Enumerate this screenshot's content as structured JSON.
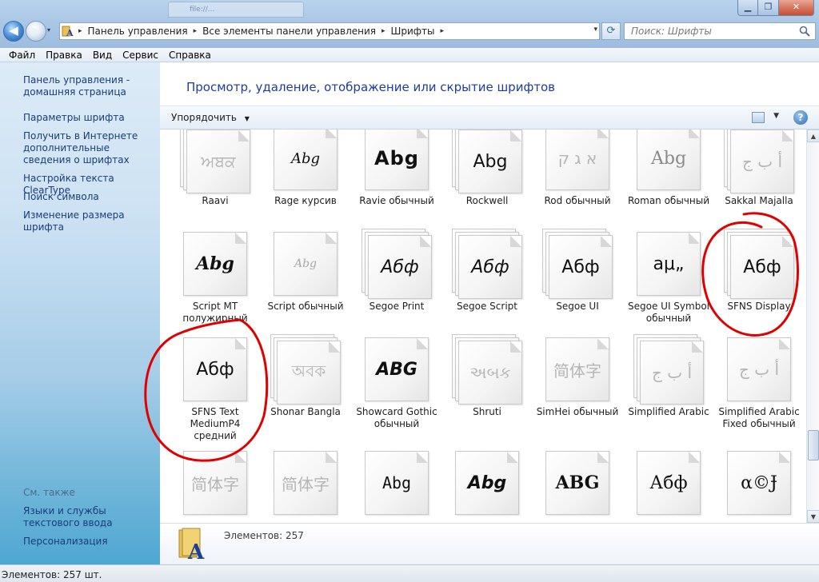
{
  "window": {
    "ghost_tab": "file://...",
    "min": "▁",
    "max": "❐",
    "close": "✕"
  },
  "nav": {
    "back": "◀",
    "forward": "▶",
    "dropdown": "▾"
  },
  "address": {
    "segments": [
      "Панель управления",
      "Все элементы панели управления",
      "Шрифты"
    ],
    "separator": "▸",
    "icon": "fonts-folder-icon"
  },
  "search": {
    "placeholder": "Поиск: Шрифты"
  },
  "menu": [
    "Файл",
    "Правка",
    "Вид",
    "Сервис",
    "Справка"
  ],
  "sidebar": {
    "tasks": [
      "Панель управления - домашняя страница",
      "Параметры шрифта",
      "Получить в Интернете дополнительные сведения о шрифтах",
      "Настройка текста ClearType",
      "Поиск символа",
      "Изменение размера шрифта"
    ],
    "see_also_title": "См. также",
    "see_also": [
      "Языки и службы текстового ввода",
      "Персонализация"
    ]
  },
  "main": {
    "title": "Просмотр, удаление, отображение или скрытие шрифтов",
    "organize": "Упорядочить",
    "help": "?"
  },
  "fonts": [
    {
      "name": "Raavi",
      "glyph": "ਅਬਕ",
      "style": "faded",
      "stack": 3
    },
    {
      "name": "Rage курсив",
      "glyph": "Abg",
      "style": "rage",
      "stack": 1
    },
    {
      "name": "Ravie обычный",
      "glyph": "Abg",
      "style": "ravie",
      "stack": 1
    },
    {
      "name": "Rockwell",
      "glyph": "Abg",
      "style": "rockwell",
      "stack": 3
    },
    {
      "name": "Rod обычный",
      "glyph": "א ג ק",
      "style": "faded",
      "stack": 1
    },
    {
      "name": "Roman обычный",
      "glyph": "Abg",
      "style": "roman",
      "stack": 1
    },
    {
      "name": "Sakkal Majalla",
      "glyph": "أ ب ج",
      "style": "faded",
      "stack": 3
    },
    {
      "name": "Script MT полужирный",
      "glyph": "Abg",
      "style": "scriptmt",
      "stack": 1
    },
    {
      "name": "Script обычный",
      "glyph": "Abg",
      "style": "scriptfaded",
      "stack": 1
    },
    {
      "name": "Segoe Print",
      "glyph": "Абф",
      "style": "print",
      "stack": 3
    },
    {
      "name": "Segoe Script",
      "glyph": "Абф",
      "style": "print",
      "stack": 3
    },
    {
      "name": "Segoe UI",
      "glyph": "Абф",
      "style": "plain",
      "stack": 3
    },
    {
      "name": "Segoe UI Symbol обычный",
      "glyph": "aμ„",
      "style": "plain",
      "stack": 1
    },
    {
      "name": "SFNS Display",
      "glyph": "Абф",
      "style": "plain",
      "stack": 3
    },
    {
      "name": "SFNS Text MediumP4 средний",
      "glyph": "Абф",
      "style": "plain",
      "stack": 1
    },
    {
      "name": "Shonar Bangla",
      "glyph": "অবক",
      "style": "faded",
      "stack": 3
    },
    {
      "name": "Showcard Gothic обычный",
      "glyph": "ABG",
      "style": "showcard",
      "stack": 1
    },
    {
      "name": "Shruti",
      "glyph": "અબક",
      "style": "faded",
      "stack": 3
    },
    {
      "name": "SimHei обычный",
      "glyph": "简体字",
      "style": "faded",
      "stack": 1
    },
    {
      "name": "Simplified Arabic",
      "glyph": "أ ب ج",
      "style": "faded",
      "stack": 3
    },
    {
      "name": "Simplified Arabic Fixed обычный",
      "glyph": "أ ب ج",
      "style": "faded",
      "stack": 1
    },
    {
      "name": "",
      "glyph": "简体字",
      "style": "faded",
      "stack": 1
    },
    {
      "name": "",
      "glyph": "简体字",
      "style": "faded",
      "stack": 1
    },
    {
      "name": "",
      "glyph": "Abg",
      "style": "stencil",
      "stack": 1
    },
    {
      "name": "",
      "glyph": "Abg",
      "style": "showcard",
      "stack": 1
    },
    {
      "name": "",
      "glyph": "ABG",
      "style": "bold",
      "stack": 1
    },
    {
      "name": "",
      "glyph": "Абф",
      "style": "serif",
      "stack": 1
    },
    {
      "name": "",
      "glyph": "α©Ɉ",
      "style": "serif",
      "stack": 1
    }
  ],
  "details": {
    "count_text": "Элементов: 257"
  },
  "status": {
    "text": "Элементов: 257 шт."
  },
  "colors": {
    "annotation": "#e00000",
    "link": "#1a3c78",
    "title": "#1e3ca0"
  }
}
